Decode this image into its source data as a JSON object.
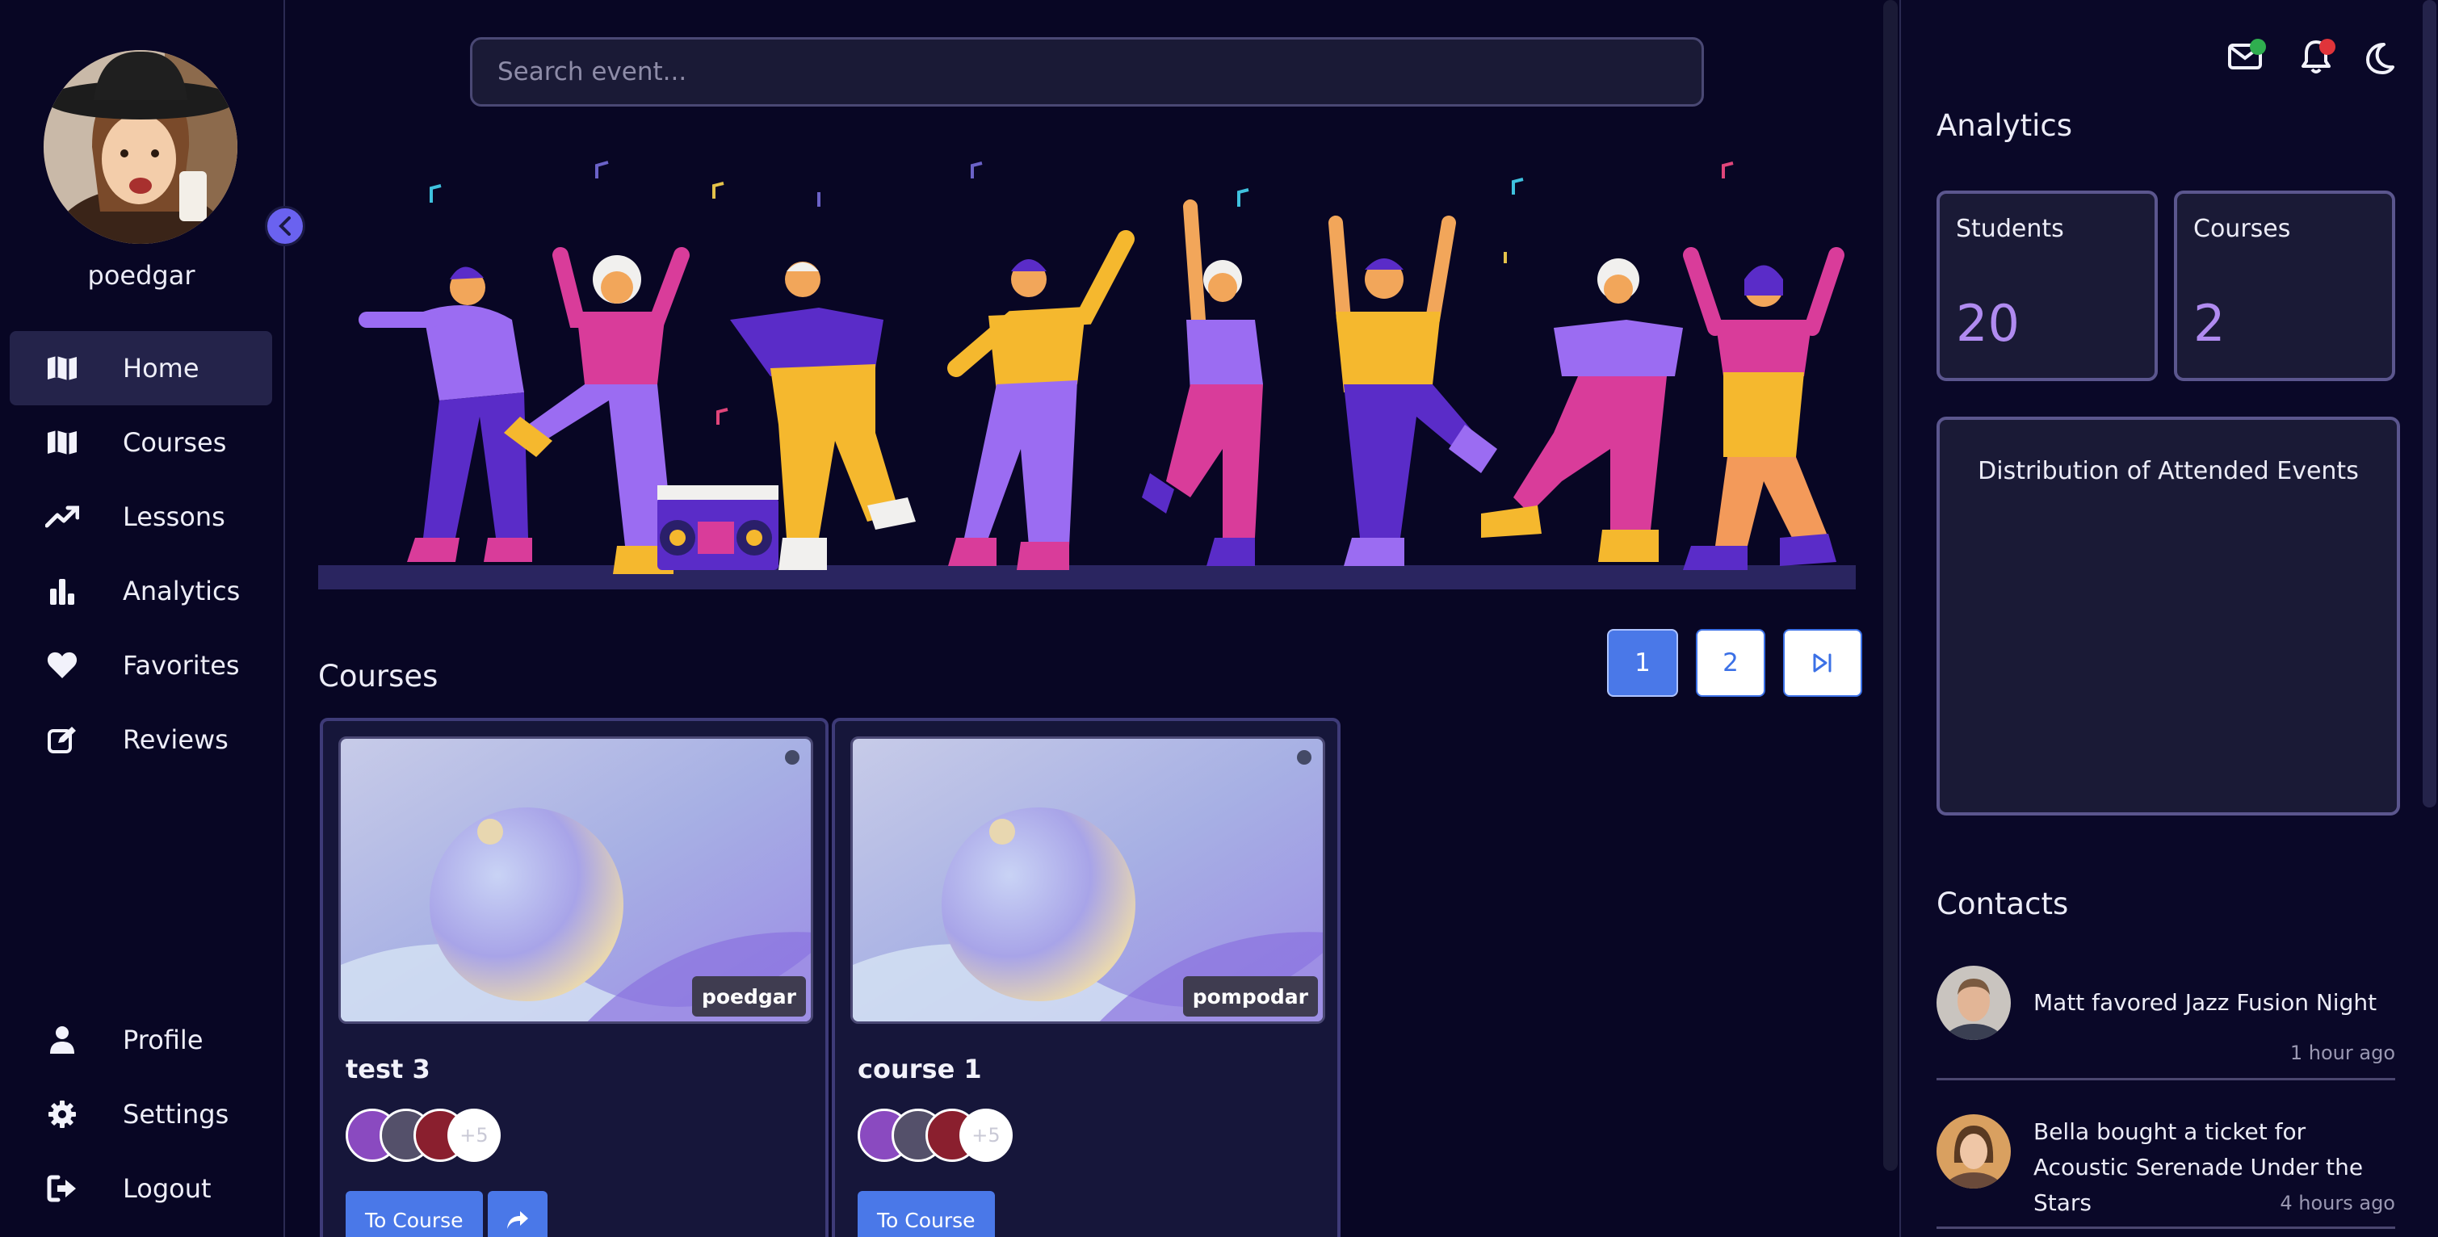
{
  "sidebar": {
    "username": "poedgar",
    "nav": [
      {
        "label": "Home",
        "icon": "map-icon",
        "active": true
      },
      {
        "label": "Courses",
        "icon": "map-icon",
        "active": false
      },
      {
        "label": "Lessons",
        "icon": "trend-up-icon",
        "active": false
      },
      {
        "label": "Analytics",
        "icon": "bar-chart-icon",
        "active": false
      },
      {
        "label": "Favorites",
        "icon": "heart-icon",
        "active": false
      },
      {
        "label": "Reviews",
        "icon": "edit-icon",
        "active": false
      }
    ],
    "bottom_nav": [
      {
        "label": "Profile",
        "icon": "user-icon"
      },
      {
        "label": "Settings",
        "icon": "gear-icon"
      },
      {
        "label": "Logout",
        "icon": "logout-icon"
      }
    ]
  },
  "search": {
    "placeholder": "Search event..."
  },
  "courses_section": {
    "title": "Courses",
    "pagination": {
      "pages": [
        "1",
        "2"
      ],
      "current": "1"
    },
    "cards": [
      {
        "title": "test 3",
        "author": "poedgar",
        "extra_count": "+5",
        "button_label": "To Course",
        "has_share": true
      },
      {
        "title": "course 1",
        "author": "pompodar",
        "extra_count": "+5",
        "button_label": "To Course",
        "has_share": false
      }
    ]
  },
  "analytics": {
    "title": "Analytics",
    "stats": [
      {
        "label": "Students",
        "value": "20"
      },
      {
        "label": "Courses",
        "value": "2"
      }
    ],
    "distribution_title": "Distribution of Attended Events"
  },
  "contacts": {
    "title": "Contacts",
    "items": [
      {
        "text": "Matt favored Jazz Fusion Night",
        "time": "1 hour ago"
      },
      {
        "text": "Bella bought a ticket for Acoustic Serenade Under the Stars",
        "time": "4 hours ago"
      }
    ]
  },
  "colors": {
    "background": "#080624",
    "accent_blue": "#4a78e8",
    "accent_purple": "#b08bf0",
    "mail_dot": "#2fae4f",
    "bell_dot": "#e0343a"
  }
}
